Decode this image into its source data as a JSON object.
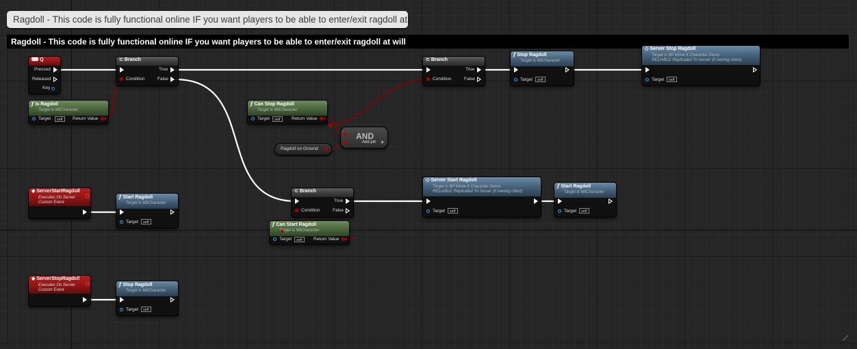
{
  "comment": {
    "bubble_text": "Ragdoll - This code is fully functional online IF you want players to be able to enter/exit ragdoll at will",
    "title": "Ragdoll - This code is fully functional online IF you want players to be able to enter/exit ragdoll at will"
  },
  "nodes": {
    "q_key": {
      "title": "Q",
      "pressed": "Pressed",
      "released": "Released",
      "key": "Key"
    },
    "is_ragdoll": {
      "title": "Is Ragdoll",
      "subtitle": "Target is MiiCharacter",
      "target": "Target",
      "self": "self",
      "return_value": "Return Value"
    },
    "branch1": {
      "title": "Branch",
      "condition": "Condition",
      "true": "True",
      "false": "False"
    },
    "branch2": {
      "title": "Branch",
      "condition": "Condition",
      "true": "True",
      "false": "False"
    },
    "branch3": {
      "title": "Branch",
      "condition": "Condition",
      "true": "True",
      "false": "False"
    },
    "stop_ragdoll_top": {
      "title": "Stop Ragdoll",
      "subtitle": "Target is MiiCharacter",
      "target": "Target",
      "self": "self"
    },
    "server_stop_ragdoll": {
      "title": "Server Stop Ragdoll",
      "subtitle1": "Target is BP Move It Character Demo",
      "subtitle2": "RELIABLE Replicated To Server (if owning client)",
      "target": "Target",
      "self": "self"
    },
    "can_stop_ragdoll": {
      "title": "Can Stop Ragdoll",
      "subtitle": "Target is MiiCharacter",
      "target": "Target",
      "self": "self",
      "return_value": "Return Value"
    },
    "and_node": {
      "title": "AND",
      "add_pin": "Add pin"
    },
    "ragdoll_on_ground": {
      "title": "Ragdoll on Ground"
    },
    "server_start_ragdoll_event": {
      "title": "ServerStartRagdoll",
      "subtitle1": "Executes On Server",
      "subtitle2": "Custom Event"
    },
    "start_ragdoll_left": {
      "title": "Start Ragdoll",
      "subtitle": "Target is MiiCharacter",
      "target": "Target",
      "self": "self"
    },
    "can_start_ragdoll": {
      "title": "Can Start Ragdoll",
      "subtitle": "Target is MiiCharacter",
      "target": "Target",
      "self": "self",
      "return_value": "Return Value"
    },
    "server_start_ragdoll": {
      "title": "Server Start Ragdoll",
      "subtitle1": "Target is BP Move It Character Demo",
      "subtitle2": "RELIABLE Replicated To Server (if owning client)",
      "target": "Target",
      "self": "self"
    },
    "start_ragdoll_right": {
      "title": "Start Ragdoll",
      "subtitle": "Target is MiiCharacter",
      "target": "Target",
      "self": "self"
    },
    "server_stop_ragdoll_event": {
      "title": "ServerStopRagdoll",
      "subtitle1": "Executes On Server",
      "subtitle2": "Custom Event"
    },
    "stop_ragdoll_bottom": {
      "title": "Stop Ragdoll",
      "subtitle": "Target is MiiCharacter",
      "target": "Target",
      "self": "self"
    }
  },
  "icons": {
    "function": "f",
    "event": "event-diamond-icon",
    "branch": "branch-icon",
    "key": "keyboard-icon"
  },
  "colors": {
    "exec_wire": "#ffffff",
    "bool_wire": "#8c0000",
    "function_header": "#3f5a72",
    "pure_header": "#466239",
    "event_header": "#8a1515",
    "comment_title": "#000000"
  }
}
